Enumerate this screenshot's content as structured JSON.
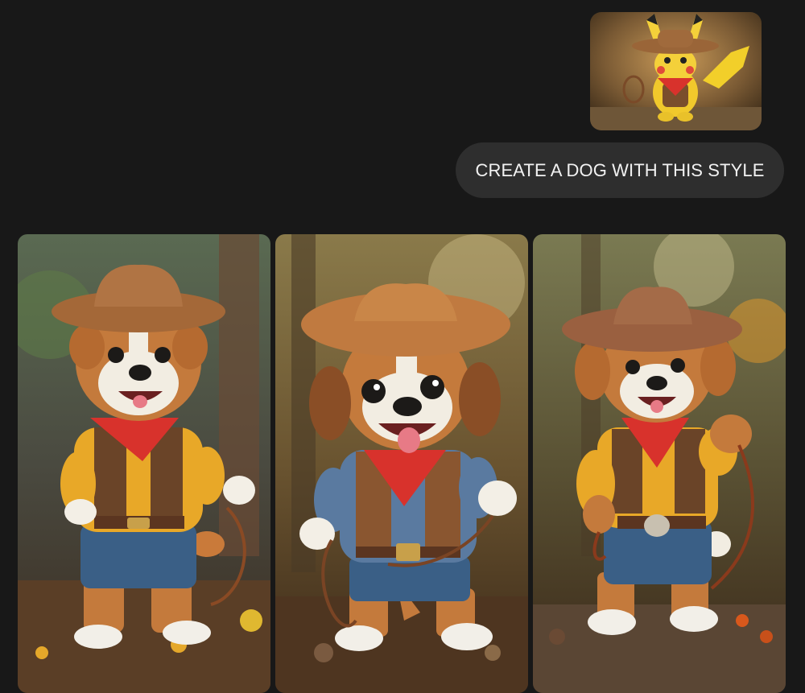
{
  "colors": {
    "background": "#181818",
    "bubble": "#2e2e2e",
    "bubble_text": "#f2f2f2"
  },
  "conversation": {
    "user_message": {
      "attachment": {
        "kind": "image",
        "subject": "pikachu-cowboy-figure"
      },
      "text": "CREATE A DOG WITH THIS STYLE"
    },
    "assistant_response": {
      "images": [
        {
          "subject": "cowboy-dog-figure",
          "variant": "yellow-shirt-brown-vest"
        },
        {
          "subject": "cowboy-dog-figure",
          "variant": "blue-shirt-brown-vest"
        },
        {
          "subject": "cowboy-dog-figure",
          "variant": "yellow-shirt-lasso"
        }
      ]
    }
  }
}
